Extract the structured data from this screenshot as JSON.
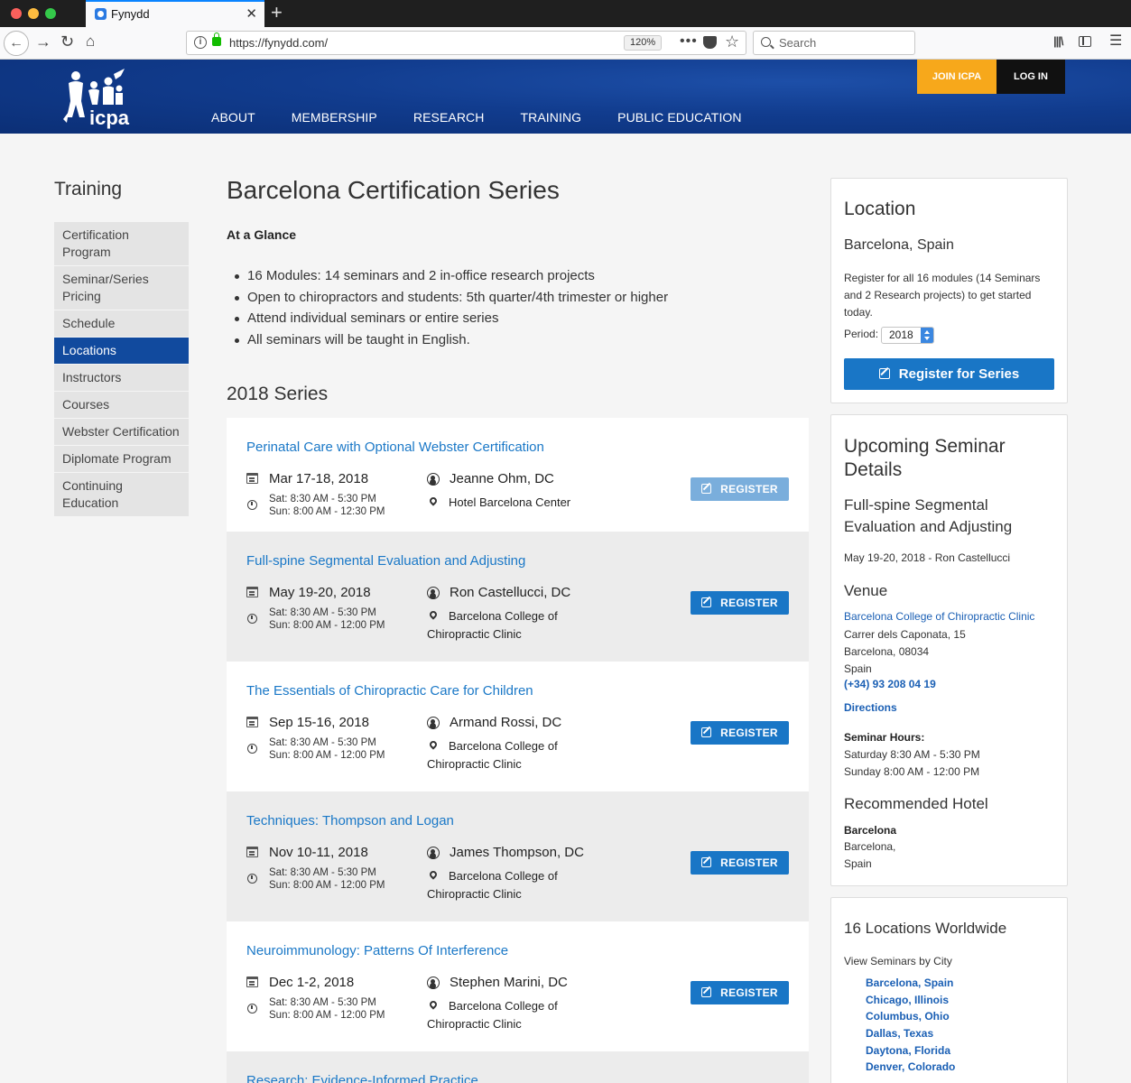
{
  "browser": {
    "tab_title": "Fynydd",
    "url": "https://fynydd.com/",
    "zoom": "120%",
    "search_placeholder": "Search"
  },
  "header": {
    "logo_text": "icpa",
    "nav": [
      "ABOUT",
      "MEMBERSHIP",
      "RESEARCH",
      "TRAINING",
      "PUBLIC EDUCATION"
    ],
    "join_label": "JOIN ICPA",
    "login_label": "LOG IN",
    "colors": {
      "brand_blue": "#113c8e",
      "join_orange": "#f7a81b"
    }
  },
  "sidebar": {
    "title": "Training",
    "items": [
      {
        "label": "Certification Program",
        "active": false
      },
      {
        "label": "Seminar/Series Pricing",
        "active": false
      },
      {
        "label": "Schedule",
        "active": false
      },
      {
        "label": "Locations",
        "active": true
      },
      {
        "label": "Instructors",
        "active": false
      },
      {
        "label": "Courses",
        "active": false
      },
      {
        "label": "Webster Certification",
        "active": false
      },
      {
        "label": "Diplomate Program",
        "active": false
      },
      {
        "label": "Continuing Education",
        "active": false
      }
    ]
  },
  "main": {
    "title": "Barcelona Certification Series",
    "glance_heading": "At a Glance",
    "bullets": [
      "16 Modules: 14 seminars and 2 in-office research projects",
      "Open to chiropractors and students: 5th quarter/4th trimester or higher",
      "Attend individual seminars or entire series",
      "All seminars will be taught in English."
    ],
    "series_heading": "2018 Series",
    "register_label": "REGISTER",
    "seminars": [
      {
        "title": "Perinatal Care with Optional Webster Certification",
        "date": "Mar 17-18, 2018",
        "sat": "Sat: 8:30 AM - 5:30 PM",
        "sun": "Sun: 8:00 AM - 12:30 PM",
        "instructor": "Jeanne Ohm, DC",
        "venue": "Hotel Barcelona Center"
      },
      {
        "title": "Full-spine Segmental Evaluation and Adjusting",
        "date": "May 19-20, 2018",
        "sat": "Sat: 8:30 AM - 5:30 PM",
        "sun": "Sun: 8:00 AM - 12:00 PM",
        "instructor": "Ron Castellucci, DC",
        "venue": "Barcelona College of Chiropractic Clinic"
      },
      {
        "title": "The Essentials of Chiropractic Care for Children",
        "date": "Sep 15-16, 2018",
        "sat": "Sat: 8:30 AM - 5:30 PM",
        "sun": "Sun: 8:00 AM - 12:00 PM",
        "instructor": "Armand Rossi, DC",
        "venue": "Barcelona College of Chiropractic Clinic"
      },
      {
        "title": "Techniques: Thompson and Logan",
        "date": "Nov 10-11, 2018",
        "sat": "Sat: 8:30 AM - 5:30 PM",
        "sun": "Sun: 8:00 AM - 12:00 PM",
        "instructor": "James Thompson, DC",
        "venue": "Barcelona College of Chiropractic Clinic"
      },
      {
        "title": "Neuroimmunology: Patterns Of Interference",
        "date": "Dec 1-2, 2018",
        "sat": "Sat: 8:30 AM - 5:30 PM",
        "sun": "Sun: 8:00 AM - 12:00 PM",
        "instructor": "Stephen Marini, DC",
        "venue": "Barcelona College of Chiropractic Clinic"
      },
      {
        "title": "Research: Evidence-Informed Practice"
      }
    ]
  },
  "location_panel": {
    "title": "Location",
    "city": "Barcelona, Spain",
    "description": "Register for all 16 modules (14 Seminars and 2 Research projects) to get started today.",
    "period_label": "Period:",
    "period_value": "2018",
    "register_series_label": "Register for Series"
  },
  "upcoming_panel": {
    "title": "Upcoming Seminar Details",
    "seminar": "Full-spine Segmental Evaluation and Adjusting",
    "date_instructor": "May 19-20, 2018 - Ron Castellucci",
    "venue_heading": "Venue",
    "venue_name": "Barcelona College of Chiropractic Clinic",
    "address": [
      "Carrer dels Caponata, 15",
      "Barcelona, 08034",
      "Spain"
    ],
    "phone": "(+34) 93 208 04 19",
    "directions": "Directions",
    "hours_heading": "Seminar Hours:",
    "hours_sat": "Saturday 8:30 AM - 5:30 PM",
    "hours_sun": "Sunday 8:00 AM - 12:00 PM",
    "hotel_heading": "Recommended Hotel",
    "hotel_name": "Barcelona",
    "hotel_city": "Barcelona,",
    "hotel_country": "Spain"
  },
  "worldwide_panel": {
    "title": "16 Locations Worldwide",
    "subtitle": "View Seminars by City",
    "cities": [
      "Barcelona, Spain",
      "Chicago, Illinois",
      "Columbus, Ohio",
      "Dallas, Texas",
      "Daytona, Florida",
      "Denver, Colorado"
    ]
  }
}
